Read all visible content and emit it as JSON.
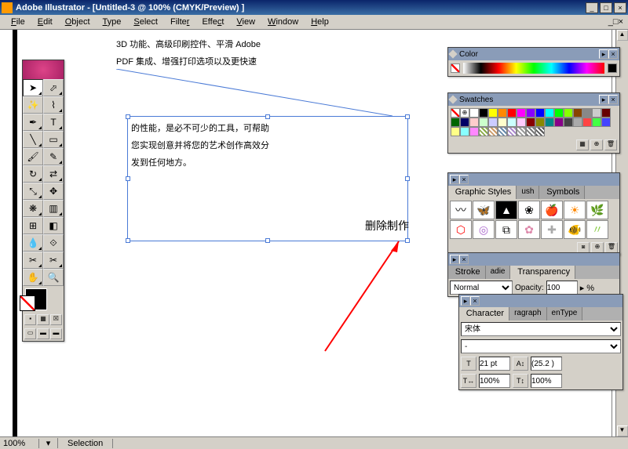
{
  "titlebar": {
    "app": "Adobe Illustrator",
    "doc": "[Untitled-3 @ 100% (CMYK/Preview) ]"
  },
  "win_controls": {
    "min": "_",
    "max": "□",
    "close": "×"
  },
  "menus": [
    "File",
    "Edit",
    "Object",
    "Type",
    "Select",
    "Filter",
    "Effect",
    "View",
    "Window",
    "Help"
  ],
  "canvas": {
    "text1_line1": "3D 功能、高级印刷控件、平滑 Adobe",
    "text1_line2": "PDF 集成、增强打印选项以及更快速",
    "textbox_line1": "的性能，是必不可少的工具，可帮助",
    "textbox_line2": "您实现创意并将您的艺术创作高效分",
    "textbox_line3": "发到任何地方。",
    "annotation": "删除制作"
  },
  "status": {
    "zoom": "100%",
    "mode": "Selection"
  },
  "panels": {
    "color": {
      "title": "Color"
    },
    "swatches": {
      "title": "Swatches"
    },
    "styles": {
      "tab1": "Graphic Styles",
      "tab2": "ush",
      "tab3": "Symbols"
    },
    "stroke": {
      "tab1": "Stroke",
      "tab2": "adie",
      "tab3": "Transparency",
      "blend": "Normal",
      "opacity_lbl": "Opacity:",
      "opacity": "100",
      "pct": "%"
    },
    "character": {
      "tab1": "Character",
      "tab2": "ragraph",
      "tab3": "enType",
      "font": "宋体",
      "style": "-",
      "size": "21 pt",
      "leading": "(25.2 )",
      "hscale": "100%",
      "vscale": "100%"
    }
  },
  "swatch_colors": [
    "#fff",
    "#000",
    "#ff0",
    "#f80",
    "#f00",
    "#f0f",
    "#80f",
    "#00f",
    "#0ff",
    "#0f0",
    "#8f0",
    "#840",
    "#888",
    "#ccc",
    "#600",
    "#060",
    "#006",
    "#fcc",
    "#cfc",
    "#ccf",
    "#ffc",
    "#cff",
    "#fcf",
    "#800",
    "#880",
    "#088",
    "#808",
    "#444",
    "#aaa",
    "#f44",
    "#4f4",
    "#44f",
    "#ff8",
    "#8ff",
    "#f8f"
  ]
}
